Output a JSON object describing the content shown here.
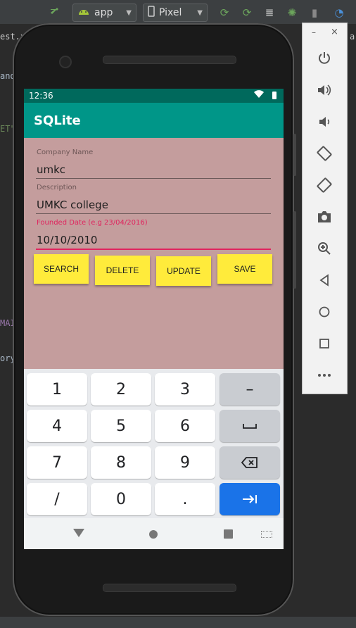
{
  "ide": {
    "toolbar": {
      "run_config": "app",
      "device": "Pixel"
    },
    "code_fragments": [
      "est.x",
      "and",
      "ET\"",
      "MAI",
      "ory"
    ],
    "right_fragment": "a"
  },
  "phone": {
    "status_bar": {
      "time": "12:36"
    },
    "app_bar": {
      "title": "SQLite"
    },
    "form": {
      "company_name": {
        "label": "Company Name",
        "value": "umkc"
      },
      "description": {
        "label": "Description",
        "value": "UMKC college"
      },
      "founded_date": {
        "label": "Founded Date (e.g 23/04/2016)",
        "value": "10/10/2010"
      }
    },
    "buttons": {
      "search": "SEARCH",
      "delete": "DELETE",
      "update": "UPDATE",
      "save": "SAVE"
    },
    "keyboard": {
      "rows": [
        [
          "1",
          "2",
          "3",
          "–"
        ],
        [
          "4",
          "5",
          "6",
          "space"
        ],
        [
          "7",
          "8",
          "9",
          "backspace"
        ],
        [
          "/",
          "0",
          ".",
          "enter"
        ]
      ]
    }
  },
  "emulator_panel": {
    "minimize": "–",
    "close": "×",
    "icons": [
      "power-icon",
      "volume-up-icon",
      "volume-down-icon",
      "rotate-left-icon",
      "rotate-right-icon",
      "camera-icon",
      "zoom-icon",
      "back-icon",
      "home-icon",
      "overview-icon",
      "more-icon"
    ]
  }
}
